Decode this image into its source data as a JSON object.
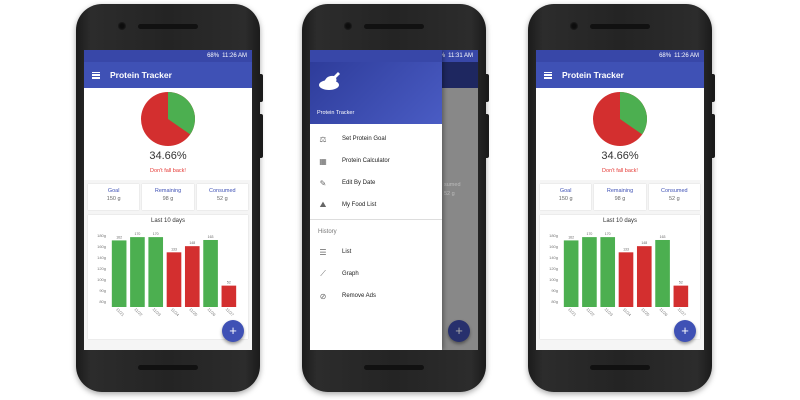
{
  "status": {
    "time_a": "11:26 AM",
    "time_b": "11:31 AM",
    "time_c": "11:26 AM",
    "battery": "68%"
  },
  "app": {
    "title": "Protein Tracker",
    "percent": "34.66%",
    "percent_value": 34.66,
    "motto": "Don't fall back!",
    "accent_color": "#3f51b5",
    "red": "#d32f2f",
    "green": "#4caf50"
  },
  "stats": [
    {
      "label": "Goal",
      "value": "150 g"
    },
    {
      "label": "Remaining",
      "value": "98 g"
    },
    {
      "label": "Consumed",
      "value": "52 g"
    }
  ],
  "chart_data": {
    "type": "bar",
    "title": "Last 10 days",
    "categories": [
      "11/21",
      "11/22",
      "11/23",
      "11/24",
      "11/25",
      "11/26",
      "11/27"
    ],
    "values": [
      162,
      170,
      170,
      133,
      148,
      163,
      52
    ],
    "colors": [
      "green",
      "green",
      "green",
      "red",
      "red",
      "green",
      "red"
    ],
    "goal": 150,
    "yticks": [
      "80g",
      "90g",
      "100g",
      "120g",
      "140g",
      "160g",
      "180g"
    ],
    "ylim": [
      0,
      180
    ]
  },
  "drawer": {
    "app_name": "Protein Tracker",
    "items": [
      {
        "label": "Set Protein Goal",
        "icon": "scale-icon"
      },
      {
        "label": "Protein Calculator",
        "icon": "calculator-icon"
      },
      {
        "label": "Edit By Date",
        "icon": "pencil-icon"
      },
      {
        "label": "My Food List",
        "icon": "landscape-icon"
      }
    ],
    "section": "History",
    "history_items": [
      {
        "label": "List",
        "icon": "list-icon"
      },
      {
        "label": "Graph",
        "icon": "graph-icon"
      },
      {
        "label": "Remove Ads",
        "icon": "block-icon"
      }
    ],
    "behind_text_1": "sumed",
    "behind_text_2": "52 g"
  },
  "fab_label": "+"
}
